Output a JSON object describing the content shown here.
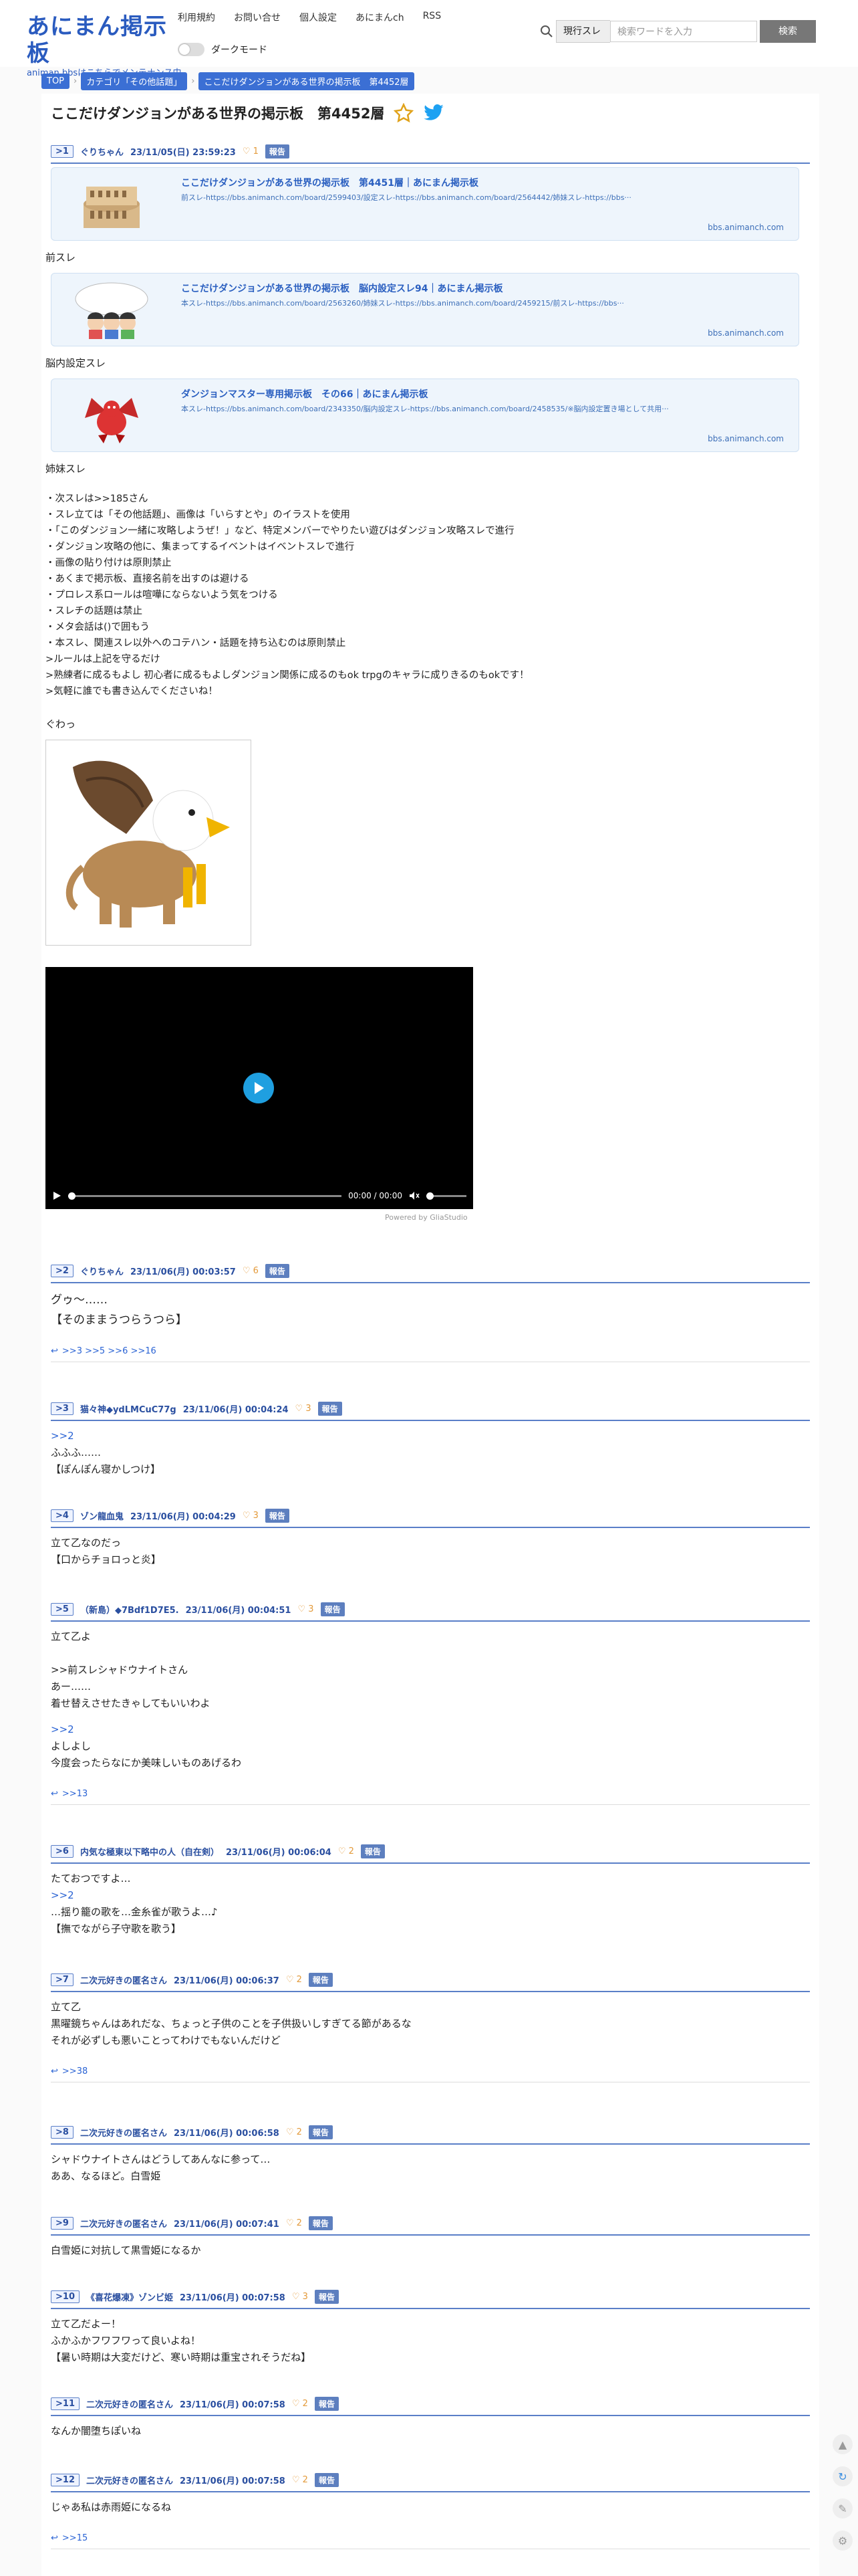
{
  "header": {
    "logo": "あにまん掲示板",
    "logo_sub": "animan bbsはこちらでメンテナンス中",
    "nav": [
      "利用規約",
      "お問い合せ",
      "個人設定",
      "あにまんch",
      "RSS"
    ],
    "darkmode_label": "ダークモード",
    "search_scope": "現行スレ",
    "search_placeholder": "検索ワードを入力",
    "search_button": "検索"
  },
  "breadcrumbs": [
    "TOP",
    "カテゴリ「その他話題」",
    "ここだけダンジョンがある世界の掲示板　第4452層"
  ],
  "thread_title": "ここだけダンジョンがある世界の掲示板　第4452層",
  "posts": [
    {
      "num": ">1",
      "name": "ぐりちゃん",
      "date": "23/11/05(日) 23:59:23",
      "hearts": "1"
    },
    {
      "num": ">2",
      "name": "ぐりちゃん",
      "date": "23/11/06(月) 00:03:57",
      "hearts": "6",
      "body": "グゥ〜……\n【そのままうつらうつら】",
      "replies": ">>3 >>5 >>6 >>16"
    },
    {
      "num": ">3",
      "name": "猫々神◆ydLMCuC77g",
      "date": "23/11/06(月) 00:04:24",
      "hearts": "3",
      "anchor": ">>2",
      "body": "ふふふ……\n【ぽんぽん寝かしつけ】"
    },
    {
      "num": ">4",
      "name": "ゾン龍血鬼",
      "date": "23/11/06(月) 00:04:29",
      "hearts": "3",
      "body": "立て乙なのだっ\n【口からチョロっと炎】"
    },
    {
      "num": ">5",
      "name": "（新島）◆7Bdf1D7E5.",
      "date": "23/11/06(月) 00:04:51",
      "hearts": "3",
      "body": "立て乙よ\n\n>>前スレシャドウナイトさん\nあー……\n着せ替えさせたきゃしてもいいわよ",
      "anchor2": ">>2",
      "body2": "よしよし\n今度会ったらなにか美味しいものあげるわ",
      "replies": ">>13"
    },
    {
      "num": ">6",
      "name": "内気な極東以下略中の人（自在剣）",
      "date": "23/11/06(月) 00:06:04",
      "hearts": "2",
      "body": "たておつですよ…",
      "anchor": ">>2",
      "body2": "…揺り籠の歌を…金糸雀が歌うよ…♪\n【撫でながら子守歌を歌う】"
    },
    {
      "num": ">7",
      "name": "二次元好きの匿名さん",
      "date": "23/11/06(月) 00:06:37",
      "hearts": "2",
      "body": "立て乙\n黒曜鏡ちゃんはあれだな、ちょっと子供のことを子供扱いしすぎてる節があるな\nそれが必ずしも悪いことってわけでもないんだけど",
      "replies": ">>38"
    },
    {
      "num": ">8",
      "name": "二次元好きの匿名さん",
      "date": "23/11/06(月) 00:06:58",
      "hearts": "2",
      "body": "シャドウナイトさんはどうしてあんなに参って…\nああ、なるほど。白雪姫"
    },
    {
      "num": ">9",
      "name": "二次元好きの匿名さん",
      "date": "23/11/06(月) 00:07:41",
      "hearts": "2",
      "body": "白雪姫に対抗して黒雪姫になるか"
    },
    {
      "num": ">10",
      "name": "《喜花爆凍》ゾンビ姫",
      "date": "23/11/06(月) 00:07:58",
      "hearts": "3",
      "body": "立て乙だよー！\nふかふかフワフワって良いよね！\n【暑い時期は大変だけど、寒い時期は重宝されそうだね】"
    },
    {
      "num": ">11",
      "name": "二次元好きの匿名さん",
      "date": "23/11/06(月) 00:07:58",
      "hearts": "2",
      "body": "なんか闇堕ちぽいね"
    },
    {
      "num": ">12",
      "name": "二次元好きの匿名さん",
      "date": "23/11/06(月) 00:07:58",
      "hearts": "2",
      "body": "じゃあ私は赤雨姫になるね",
      "replies": ">>15"
    }
  ],
  "cards": [
    {
      "title": "ここだけダンジョンがある世界の掲示板　第4451層｜あにまん掲示板",
      "desc": "前スレ-https://bbs.animanch.com/board/2599403/設定スレ-https://bbs.animanch.com/board/2564442/姉妹スレ-https://bbs···",
      "domain": "bbs.animanch.com",
      "caption": "前スレ"
    },
    {
      "title": "ここだけダンジョンがある世界の掲示板　脳内設定スレ94｜あにまん掲示板",
      "desc": "本スレ-https://bbs.animanch.com/board/2563260/姉妹スレ-https://bbs.animanch.com/board/2459215/前スレ-https://bbs···",
      "domain": "bbs.animanch.com",
      "caption": "脳内設定スレ"
    },
    {
      "title": "ダンジョンマスター専用掲示板　その66｜あにまん掲示板",
      "desc": "本スレ-https://bbs.animanch.com/board/2343350/脳内設定スレ-https://bbs.animanch.com/board/2458535/※脳内設定置き場として共用···",
      "domain": "bbs.animanch.com",
      "caption": "姉妹スレ"
    }
  ],
  "op_rules": "・次スレは>>185さん\n・スレ立ては「その他話題」、画像は「いらすとや」のイラストを使用\n・「このダンジョン一緒に攻略しようぜ！」など、特定メンバーでやりたい遊びはダンジョン攻略スレで進行\n・ダンジョン攻略の他に、集まってするイベントはイベントスレで進行\n・画像の貼り付けは原則禁止\n・あくまで掲示板、直接名前を出すのは避ける\n・プロレス系ロールは喧嘩にならないよう気をつける\n・スレチの話題は禁止\n・メタ会話は()で囲もう\n・本スレ、関連スレ以外へのコテハン・話題を持ち込むのは原則禁止\n>ルールは上記を守るだけ\n>熟練者に成るもよし 初心者に成るもよしダンジョン関係に成るのもok trpgのキャラに成りきるのもokです！\n>気軽に誰でも書き込んでくださいね！",
  "op_tail": "ぐわっ",
  "video": {
    "time": "00:00 / 00:00",
    "credit": "Powered by GliaStudio"
  }
}
